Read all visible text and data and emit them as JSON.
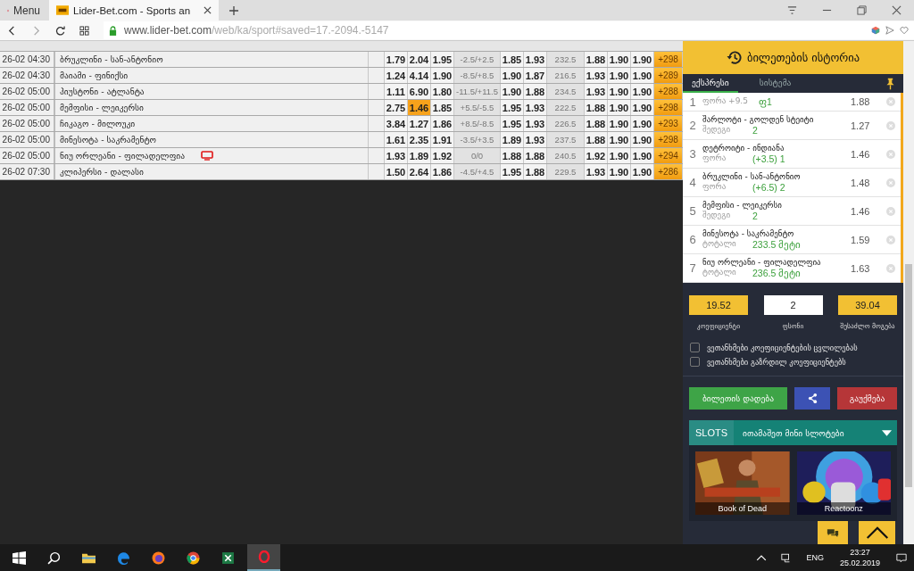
{
  "browser": {
    "menu": "Menu",
    "tabs": [
      {
        "title": "Lider-Bet.com - Sports an",
        "selected": true
      }
    ],
    "url_host": "www.lider-bet.com",
    "url_path": "/web/ka/sport#saved=17.-2094.-5147"
  },
  "events": [
    {
      "time": "26-02 04:30",
      "teams": "ბრუკლინი - სან-ანტონიო",
      "tv": false,
      "more": "+298",
      "cells": [
        {
          "t": "1.79",
          "kind": "odd",
          "selected": false
        },
        {
          "t": "2.04",
          "kind": "odd",
          "selected": false
        },
        {
          "t": "1.95",
          "kind": "odd",
          "selected": false
        },
        {
          "t": "-2.5/+2.5",
          "kind": "line",
          "selected": false
        },
        {
          "t": "1.85",
          "kind": "odd",
          "selected": false
        },
        {
          "t": "1.93",
          "kind": "odd",
          "selected": false
        },
        {
          "t": "232.5",
          "kind": "line",
          "selected": false
        },
        {
          "t": "1.88",
          "kind": "odd",
          "selected": false
        },
        {
          "t": "1.90",
          "kind": "odd",
          "selected": false
        },
        {
          "t": "1.90",
          "kind": "odd",
          "selected": false
        }
      ]
    },
    {
      "time": "26-02 04:30",
      "teams": "მაიამი - ფინიქსი",
      "tv": false,
      "more": "+289",
      "cells": [
        {
          "t": "1.24",
          "kind": "odd",
          "selected": false
        },
        {
          "t": "4.14",
          "kind": "odd",
          "selected": false
        },
        {
          "t": "1.90",
          "kind": "odd",
          "selected": false
        },
        {
          "t": "-8.5/+8.5",
          "kind": "line",
          "selected": false
        },
        {
          "t": "1.90",
          "kind": "odd",
          "selected": false
        },
        {
          "t": "1.87",
          "kind": "odd",
          "selected": false
        },
        {
          "t": "216.5",
          "kind": "line",
          "selected": false
        },
        {
          "t": "1.93",
          "kind": "odd",
          "selected": false
        },
        {
          "t": "1.90",
          "kind": "odd",
          "selected": false
        },
        {
          "t": "1.90",
          "kind": "odd",
          "selected": false
        }
      ]
    },
    {
      "time": "26-02 05:00",
      "teams": "ჰიუსტონი - ატლანტა",
      "tv": false,
      "more": "+288",
      "cells": [
        {
          "t": "1.11",
          "kind": "odd",
          "selected": false
        },
        {
          "t": "6.90",
          "kind": "odd",
          "selected": false
        },
        {
          "t": "1.80",
          "kind": "odd",
          "selected": false
        },
        {
          "t": "-11.5/+11.5",
          "kind": "line",
          "selected": false
        },
        {
          "t": "1.90",
          "kind": "odd",
          "selected": false
        },
        {
          "t": "1.88",
          "kind": "odd",
          "selected": false
        },
        {
          "t": "234.5",
          "kind": "line",
          "selected": false
        },
        {
          "t": "1.93",
          "kind": "odd",
          "selected": false
        },
        {
          "t": "1.90",
          "kind": "odd",
          "selected": false
        },
        {
          "t": "1.90",
          "kind": "odd",
          "selected": false
        }
      ]
    },
    {
      "time": "26-02 05:00",
      "teams": "მემფისი - ლეიკერსი",
      "tv": false,
      "more": "+298",
      "cells": [
        {
          "t": "2.75",
          "kind": "odd",
          "selected": false
        },
        {
          "t": "1.46",
          "kind": "odd",
          "selected": true
        },
        {
          "t": "1.85",
          "kind": "odd",
          "selected": false
        },
        {
          "t": "+5.5/-5.5",
          "kind": "line",
          "selected": false
        },
        {
          "t": "1.95",
          "kind": "odd",
          "selected": false
        },
        {
          "t": "1.93",
          "kind": "odd",
          "selected": false
        },
        {
          "t": "222.5",
          "kind": "line",
          "selected": false
        },
        {
          "t": "1.88",
          "kind": "odd",
          "selected": false
        },
        {
          "t": "1.90",
          "kind": "odd",
          "selected": false
        },
        {
          "t": "1.90",
          "kind": "odd",
          "selected": false
        }
      ]
    },
    {
      "time": "26-02 05:00",
      "teams": "ჩიკაგო - მილოუკი",
      "tv": false,
      "more": "+293",
      "cells": [
        {
          "t": "3.84",
          "kind": "odd",
          "selected": false
        },
        {
          "t": "1.27",
          "kind": "odd",
          "selected": false
        },
        {
          "t": "1.86",
          "kind": "odd",
          "selected": false
        },
        {
          "t": "+8.5/-8.5",
          "kind": "line",
          "selected": false
        },
        {
          "t": "1.95",
          "kind": "odd",
          "selected": false
        },
        {
          "t": "1.93",
          "kind": "odd",
          "selected": false
        },
        {
          "t": "226.5",
          "kind": "line",
          "selected": false
        },
        {
          "t": "1.88",
          "kind": "odd",
          "selected": false
        },
        {
          "t": "1.90",
          "kind": "odd",
          "selected": false
        },
        {
          "t": "1.90",
          "kind": "odd",
          "selected": false
        }
      ]
    },
    {
      "time": "26-02 05:00",
      "teams": "მინესოტა - საკრამენტო",
      "tv": false,
      "more": "+298",
      "cells": [
        {
          "t": "1.61",
          "kind": "odd",
          "selected": false
        },
        {
          "t": "2.35",
          "kind": "odd",
          "selected": false
        },
        {
          "t": "1.91",
          "kind": "odd",
          "selected": false
        },
        {
          "t": "-3.5/+3.5",
          "kind": "line",
          "selected": false
        },
        {
          "t": "1.89",
          "kind": "odd",
          "selected": false
        },
        {
          "t": "1.93",
          "kind": "odd",
          "selected": false
        },
        {
          "t": "237.5",
          "kind": "line",
          "selected": false
        },
        {
          "t": "1.88",
          "kind": "odd",
          "selected": false
        },
        {
          "t": "1.90",
          "kind": "odd",
          "selected": false
        },
        {
          "t": "1.90",
          "kind": "odd",
          "selected": false
        }
      ]
    },
    {
      "time": "26-02 05:00",
      "teams": "ნიუ ორლეანი - ფილადელფია",
      "tv": true,
      "more": "+294",
      "cells": [
        {
          "t": "1.93",
          "kind": "odd",
          "selected": false
        },
        {
          "t": "1.89",
          "kind": "odd",
          "selected": false
        },
        {
          "t": "1.92",
          "kind": "odd",
          "selected": false
        },
        {
          "t": "0/0",
          "kind": "line",
          "selected": false
        },
        {
          "t": "1.88",
          "kind": "odd",
          "selected": false
        },
        {
          "t": "1.88",
          "kind": "odd",
          "selected": false
        },
        {
          "t": "240.5",
          "kind": "line",
          "selected": false
        },
        {
          "t": "1.92",
          "kind": "odd",
          "selected": false
        },
        {
          "t": "1.90",
          "kind": "odd",
          "selected": false
        },
        {
          "t": "1.90",
          "kind": "odd",
          "selected": false
        }
      ]
    },
    {
      "time": "26-02 07:30",
      "teams": "კლიპერსი - დალასი",
      "tv": false,
      "more": "+286",
      "cells": [
        {
          "t": "1.50",
          "kind": "odd",
          "selected": false
        },
        {
          "t": "2.64",
          "kind": "odd",
          "selected": false
        },
        {
          "t": "1.86",
          "kind": "odd",
          "selected": false
        },
        {
          "t": "-4.5/+4.5",
          "kind": "line",
          "selected": false
        },
        {
          "t": "1.95",
          "kind": "odd",
          "selected": false
        },
        {
          "t": "1.88",
          "kind": "odd",
          "selected": false
        },
        {
          "t": "229.5",
          "kind": "line",
          "selected": false
        },
        {
          "t": "1.93",
          "kind": "odd",
          "selected": false
        },
        {
          "t": "1.90",
          "kind": "odd",
          "selected": false
        },
        {
          "t": "1.90",
          "kind": "odd",
          "selected": false
        }
      ]
    }
  ],
  "ticket": {
    "title": "ბილეთების ისტორია",
    "tabs": [
      {
        "label": "ექსპრესი",
        "selected": true
      },
      {
        "label": "სისტემა",
        "selected": false
      }
    ],
    "bets": [
      {
        "n": "1",
        "market": "ფორა +9.5",
        "pick": "ფ1",
        "odds": "1.88"
      },
      {
        "n": "2",
        "teams": "შარლოტი - გოლდენ სტეიტი",
        "market": "შედეგი",
        "pick": "2",
        "odds": "1.27"
      },
      {
        "n": "3",
        "teams": "დეტროიტი - ინდიანა",
        "market": "ფორა",
        "pick": "(+3.5) 1",
        "odds": "1.46"
      },
      {
        "n": "4",
        "teams": "ბრუკლინი - სან-ანტონიო",
        "market": "ფორა",
        "pick": "(+6.5) 2",
        "odds": "1.48"
      },
      {
        "n": "5",
        "teams": "მემფისი - ლეიკერსი",
        "market": "შედეგი",
        "pick": "2",
        "odds": "1.46"
      },
      {
        "n": "6",
        "teams": "მინესოტა - საკრამენტო",
        "market": "ტოტალი",
        "pick": "233.5 მეტი",
        "odds": "1.59"
      },
      {
        "n": "7",
        "teams": "ნიუ ორლეანი - ფილადელფია",
        "market": "ტოტალი",
        "pick": "236.5 მეტი",
        "odds": "1.63"
      }
    ],
    "totals": [
      {
        "value": "19.52",
        "label": "კოეფიციენტი",
        "kind": "readout"
      },
      {
        "value": "2",
        "label": "ფსონი",
        "kind": "input"
      },
      {
        "value": "39.04",
        "label": "შესაძლო მოგება",
        "kind": "readout"
      }
    ],
    "options": [
      {
        "label": "ვეთანხმები კოეფიციენტების ცვლილებას",
        "checked": false
      },
      {
        "label": "ვეთანხმები გაზრდილ კოეფიციენტებს",
        "checked": false
      }
    ],
    "place": "ბილეთის დადება",
    "cancel": "გაუქმება"
  },
  "slots": {
    "tag": "SLOTS",
    "title": "ითამაშეთ მინი სლოტები",
    "games": [
      {
        "name": "Book of Dead",
        "kind": "picture"
      },
      {
        "name": "Reactoonz",
        "kind": "picture"
      }
    ]
  },
  "taskbar": {
    "lang": "ENG",
    "time": "23:27",
    "date": "25.02.2019"
  }
}
